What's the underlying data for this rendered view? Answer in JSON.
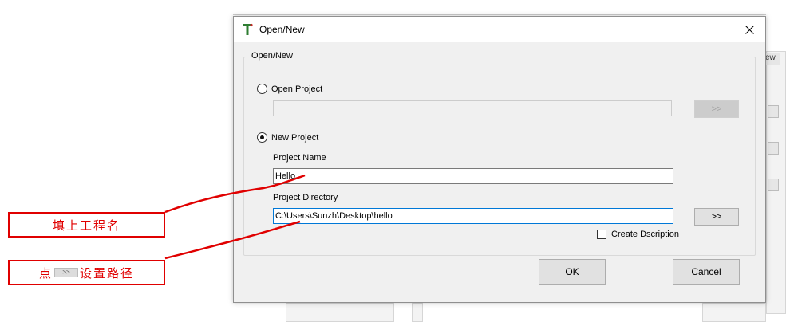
{
  "dialog": {
    "title": "Open/New",
    "close_glyph": "×",
    "group_label": "Open/New",
    "open_project_label": "Open Project",
    "open_project_path": "",
    "open_browse_label": ">>",
    "new_project_label": "New Project",
    "project_name_label": "Project Name",
    "project_name_value": "Hello",
    "project_dir_label": "Project Directory",
    "project_dir_value": "C:\\Users\\Sunzh\\Desktop\\hello",
    "dir_browse_label": ">>",
    "create_description_label": "Create Dscription",
    "create_description_checked": false,
    "ok_label": "OK",
    "cancel_label": "Cancel",
    "selected_option": "New Project"
  },
  "annotations": {
    "note1": "填上工程名",
    "note2_prefix": "点",
    "note2_button": ">>",
    "note2_suffix": "设置路径",
    "color": "#e00000"
  },
  "background": {
    "tab_fragment": "ew"
  },
  "icons": {
    "app": "tree-t-icon",
    "close": "close-icon"
  }
}
